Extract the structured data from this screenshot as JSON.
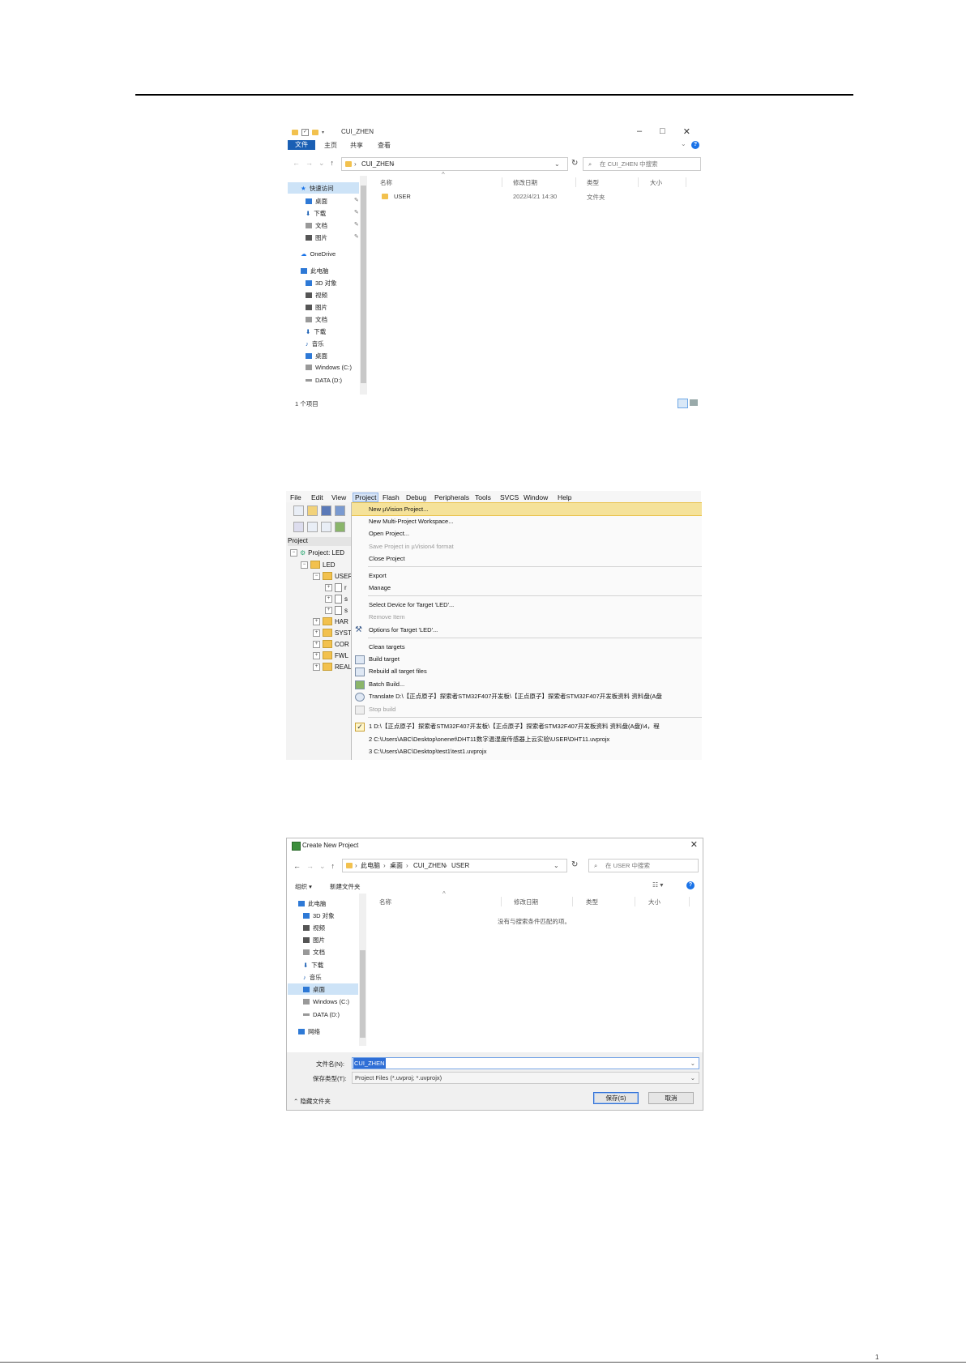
{
  "explorer": {
    "title": "CUI_ZHEN",
    "ribbon_tabs": [
      "文件",
      "主页",
      "共享",
      "查看"
    ],
    "address_path": "CUI_ZHEN",
    "search_placeholder": "在 CUI_ZHEN 中搜索",
    "nav_items": [
      "快速访问",
      "桌面",
      "下载",
      "文档",
      "图片",
      "OneDrive",
      "此电脑",
      "3D 对象",
      "视频",
      "图片",
      "文档",
      "下载",
      "音乐",
      "桌面",
      "Windows (C:)",
      "DATA (D:)"
    ],
    "columns": [
      "名称",
      "修改日期",
      "类型",
      "大小"
    ],
    "rows": [
      {
        "name": "USER",
        "modified": "2022/4/21 14:30",
        "type": "文件夹",
        "size": ""
      }
    ],
    "status": "1 个项目"
  },
  "keil": {
    "menubar": [
      "File",
      "Edit",
      "View",
      "Project",
      "Flash",
      "Debug",
      "Peripherals",
      "Tools",
      "SVCS",
      "Window",
      "Help"
    ],
    "project_header": "Project",
    "tree": [
      "Project: LED",
      "LED",
      "USER",
      "r",
      "s",
      "s",
      "HAR",
      "SYST",
      "COR",
      "FWL",
      "REAL"
    ],
    "menu_items": [
      {
        "label": "New µVision Project...",
        "state": "highlight"
      },
      {
        "label": "New Multi-Project Workspace...",
        "state": "normal"
      },
      {
        "label": "Open Project...",
        "state": "normal"
      },
      {
        "label": "Save Project in µVision4 format",
        "state": "disabled"
      },
      {
        "label": "Close Project",
        "state": "normal"
      },
      {
        "label": "Export",
        "state": "normal"
      },
      {
        "label": "Manage",
        "state": "normal"
      },
      {
        "label": "Select Device for Target 'LED'...",
        "state": "normal"
      },
      {
        "label": "Remove Item",
        "state": "disabled"
      },
      {
        "label": "Options for Target 'LED'...",
        "state": "normal"
      },
      {
        "label": "Clean targets",
        "state": "normal"
      },
      {
        "label": "Build target",
        "state": "normal"
      },
      {
        "label": "Rebuild all target files",
        "state": "normal"
      },
      {
        "label": "Batch Build...",
        "state": "normal"
      },
      {
        "label": "Translate D:\\【正点原子】探索者STM32F407开发板\\【正点原子】探索者STM32F407开发板资料 资料盘(A盘",
        "state": "normal"
      },
      {
        "label": "Stop build",
        "state": "disabled"
      },
      {
        "label": "1 D:\\【正点原子】探索者STM32F407开发板\\【正点原子】探索者STM32F407开发板资料 资料盘(A盘)\\4，程",
        "state": "normal"
      },
      {
        "label": "2 C:\\Users\\ABC\\Desktop\\onenet\\DHT11数字温湿度传感器上云实验\\USER\\DHT11.uvprojx",
        "state": "normal"
      },
      {
        "label": "3 C:\\Users\\ABC\\Desktop\\test1\\test1.uvprojx",
        "state": "normal"
      }
    ]
  },
  "dialog": {
    "title": "Create New Project",
    "breadcrumb": [
      "此电脑",
      "桌面",
      "CUI_ZHEN",
      "USER"
    ],
    "search_placeholder": "在 USER 中搜索",
    "organize": "组织 ▾",
    "new_folder": "新建文件夹",
    "nav_items": [
      "此电脑",
      "3D 对象",
      "视频",
      "图片",
      "文档",
      "下载",
      "音乐",
      "桌面",
      "Windows (C:)",
      "DATA (D:)",
      "网络"
    ],
    "columns": [
      "名称",
      "修改日期",
      "类型",
      "大小"
    ],
    "empty_message": "没有与搜索条件匹配的项。",
    "filename_label": "文件名(N):",
    "filename_value": "CUI_ZHEN",
    "savetype_label": "保存类型(T):",
    "savetype_value": "Project Files (*.uvproj; *.uvprojx)",
    "hide_folders": "隐藏文件夹",
    "save_button": "保存(S)",
    "cancel_button": "取消"
  },
  "page_number": "1"
}
